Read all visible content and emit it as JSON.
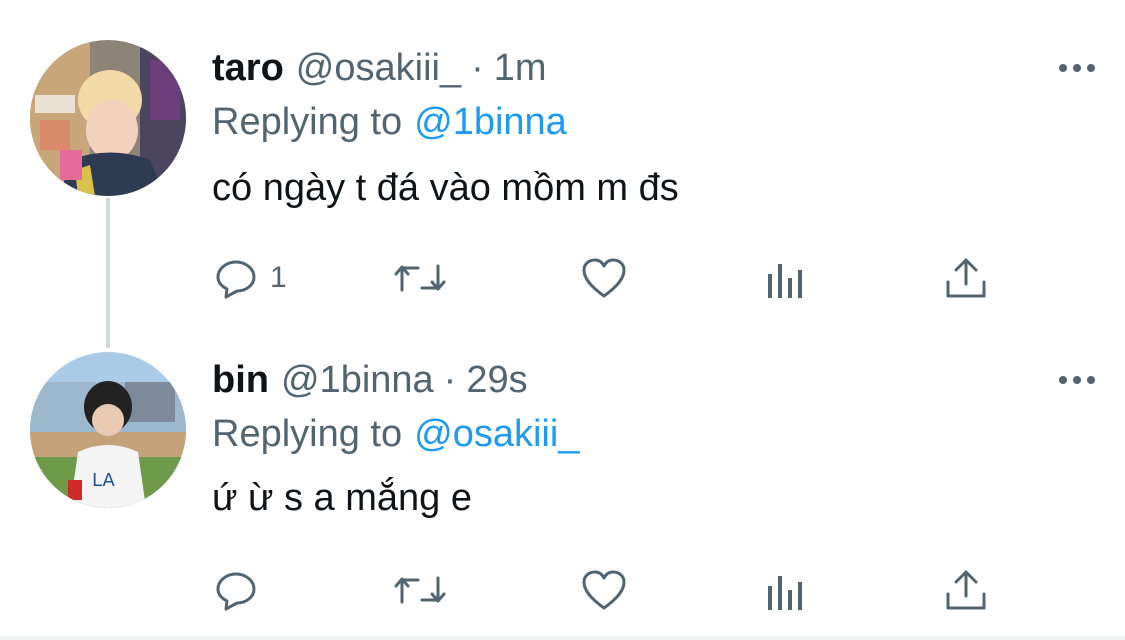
{
  "tweets": [
    {
      "name": "taro",
      "handle": "@osakiii_",
      "separator": "·",
      "time": "1m",
      "replying_prefix": "Replying to",
      "replying_to": "@1binna",
      "text": "có ngày t đá vào mồm m đs",
      "reply_count": "1",
      "avatar": "avatar-photo"
    },
    {
      "name": "bin",
      "handle": "@1binna",
      "separator": "·",
      "time": "29s",
      "replying_prefix": "Replying to",
      "replying_to": "@osakiii_",
      "text": "ứ ừ s a mắng e",
      "reply_count": "",
      "avatar": "avatar-photo"
    }
  ],
  "icons": [
    "reply-icon",
    "retweet-icon",
    "like-icon",
    "analytics-icon",
    "share-icon",
    "more-icon"
  ],
  "colors": {
    "link": "#1d9bf0",
    "secondary": "#536471",
    "text": "#0f1419",
    "thread_line": "#cfd9de"
  }
}
